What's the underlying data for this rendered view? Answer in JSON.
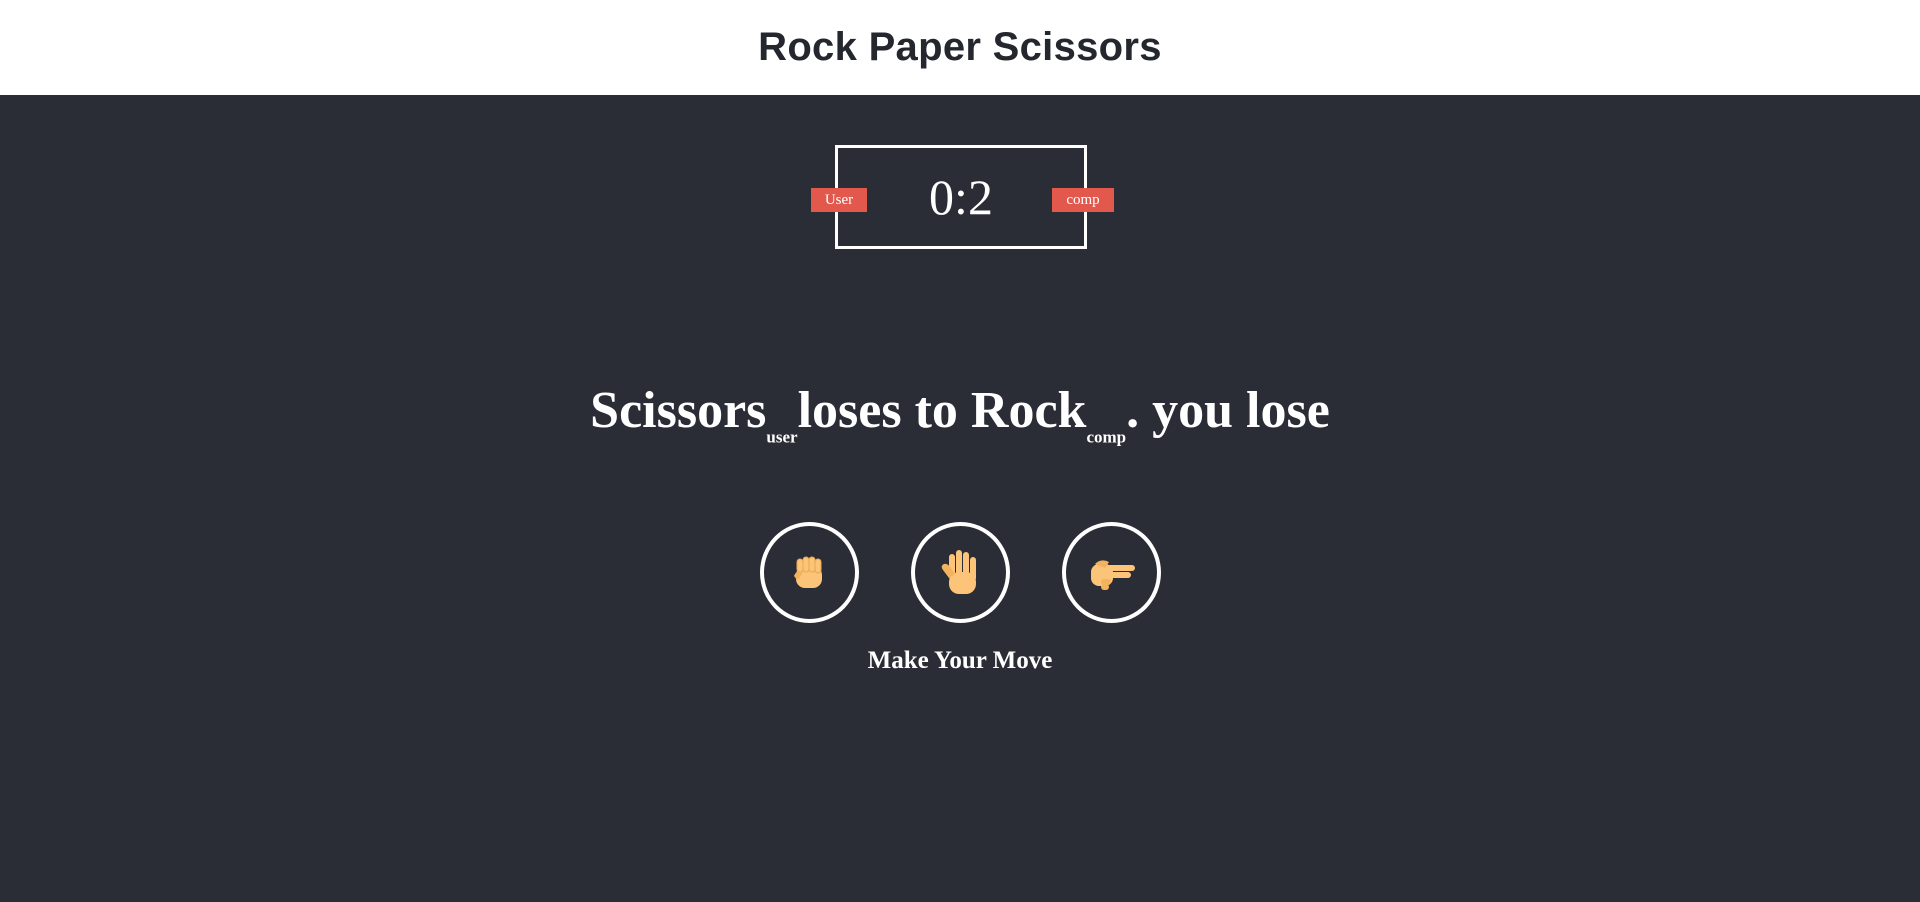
{
  "header": {
    "title": "Rock Paper Scissors"
  },
  "scoreboard": {
    "user_label": "User",
    "comp_label": "comp",
    "score": "0:2",
    "badge_color": "#e2584d"
  },
  "result": {
    "user_choice": "Scissors",
    "user_tag": "user",
    "verb": "loses to",
    "comp_choice": "Rock",
    "comp_tag": "comp",
    "outcome": ". you lose"
  },
  "choices": [
    {
      "name": "rock",
      "icon": "fist-icon"
    },
    {
      "name": "paper",
      "icon": "open-hand-icon"
    },
    {
      "name": "scissors",
      "icon": "victory-hand-icon"
    }
  ],
  "action_message": "Make Your Move",
  "colors": {
    "background": "#2a2c36",
    "header_bg": "#ffffff",
    "skin": "#fcc478"
  }
}
